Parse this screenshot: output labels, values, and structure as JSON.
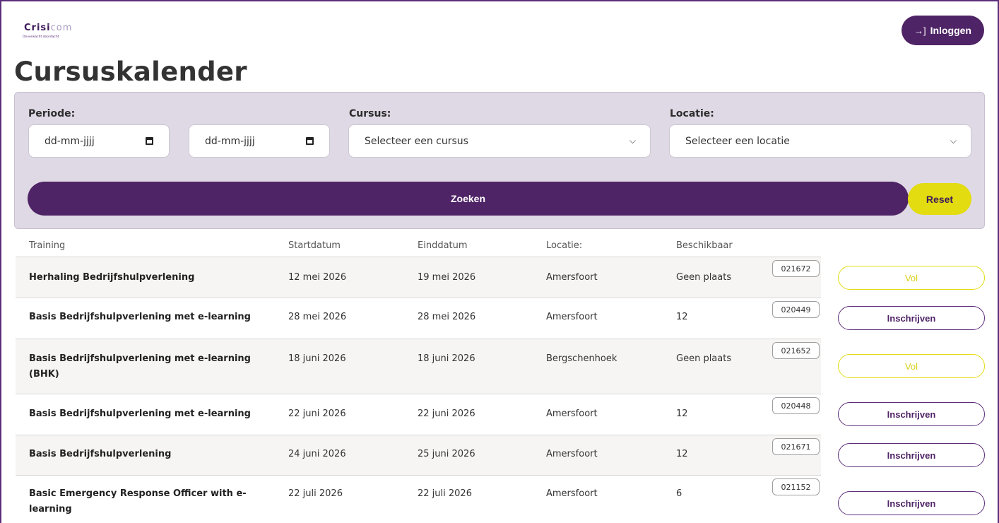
{
  "header": {
    "logo": {
      "brand_main": "Crisi",
      "brand_rest": "com",
      "tagline": "Onverwacht doordacht"
    },
    "login_label": "Inloggen",
    "login_icon": "sign-in-icon",
    "page_title": "Cursuskalender"
  },
  "filters": {
    "periode_label": "Periode:",
    "date_from_placeholder": "dd-mm-jjjj",
    "date_to_placeholder": "dd-mm-jjjj",
    "cursus_label": "Cursus:",
    "cursus_value": "Selecteer een cursus",
    "locatie_label": "Locatie:",
    "locatie_value": "Selecteer een locatie",
    "search_label": "Zoeken",
    "reset_label": "Reset"
  },
  "table": {
    "headers": [
      "Training",
      "Startdatum",
      "Einddatum",
      "Locatie:",
      "Beschikbaar"
    ],
    "rows": [
      {
        "training": "Herhaling Bedrijfshulpverlening",
        "start": "12 mei 2026",
        "end": "19 mei 2026",
        "location": "Amersfoort",
        "available": "Geen plaats",
        "code": "021672",
        "action": "Vol"
      },
      {
        "training": "Basis Bedrijfshulpverlening met e-learning",
        "start": "28 mei 2026",
        "end": "28 mei 2026",
        "location": "Amersfoort",
        "available": "12",
        "code": "020449",
        "action": "Inschrijven"
      },
      {
        "training": "Basis Bedrijfshulpverlening met e-learning (BHK)",
        "start": "18 juni 2026",
        "end": "18 juni 2026",
        "location": "Bergschenhoek",
        "available": "Geen plaats",
        "code": "021652",
        "action": "Vol"
      },
      {
        "training": "Basis Bedrijfshulpverlening met e-learning",
        "start": "22 juni 2026",
        "end": "22 juni 2026",
        "location": "Amersfoort",
        "available": "12",
        "code": "020448",
        "action": "Inschrijven"
      },
      {
        "training": "Basis Bedrijfshulpverlening",
        "start": "24 juni 2026",
        "end": "25 juni 2026",
        "location": "Amersfoort",
        "available": "12",
        "code": "021671",
        "action": "Inschrijven"
      },
      {
        "training": "Basic Emergency Response Officer with e-learning",
        "start": "22 juli 2026",
        "end": "22 juli 2026",
        "location": "Amersfoort",
        "available": "6",
        "code": "021152",
        "action": "Inschrijven"
      }
    ]
  },
  "colors": {
    "brand_purple": "#4f2466",
    "accent_yellow": "#e2dc10",
    "panel_bg": "#dfd9e5"
  }
}
